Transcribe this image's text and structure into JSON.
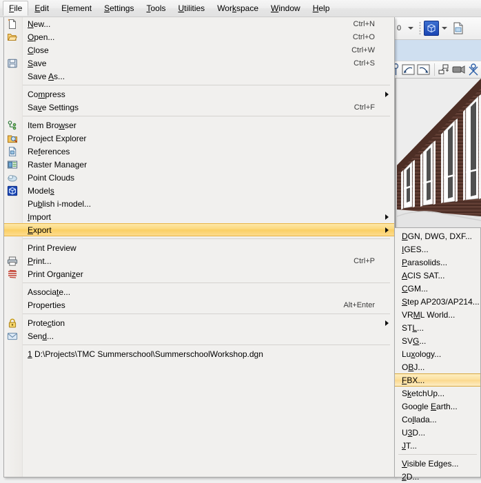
{
  "menubar": {
    "items": [
      {
        "label": "File",
        "mnemonic": "F",
        "open": true
      },
      {
        "label": "Edit",
        "mnemonic": "E",
        "open": false
      },
      {
        "label": "Element",
        "mnemonic": "l",
        "open": false
      },
      {
        "label": "Settings",
        "mnemonic": "S",
        "open": false
      },
      {
        "label": "Tools",
        "mnemonic": "T",
        "open": false
      },
      {
        "label": "Utilities",
        "mnemonic": "U",
        "open": false
      },
      {
        "label": "Workspace",
        "mnemonic": "k",
        "open": false
      },
      {
        "label": "Window",
        "mnemonic": "W",
        "open": false
      },
      {
        "label": "Help",
        "mnemonic": "H",
        "open": false
      }
    ]
  },
  "toolbar": {
    "level_value": "0",
    "level_dropdown_icon": "chevron-down-icon",
    "model_icon": "cube-icon",
    "model_dropdown_icon": "chevron-down-icon",
    "new_file_icon": "document-icon",
    "row2": [
      {
        "icon": "measure-icon"
      },
      {
        "icon": "undo-arc-icon"
      },
      {
        "icon": "redo-arc-icon"
      },
      {
        "icon": "copy-element-icon"
      },
      {
        "icon": "camera-icon"
      },
      {
        "icon": "render-icon"
      }
    ]
  },
  "viewport": {
    "name": "3d-building-render",
    "description": "Brick facade building with windows"
  },
  "file_menu": {
    "groups": [
      [
        {
          "label": "New...",
          "mnemonic": "N",
          "accel": "Ctrl+N",
          "icon": "new-document-icon",
          "submenu": false
        },
        {
          "label": "Open...",
          "mnemonic": "O",
          "accel": "Ctrl+O",
          "icon": "open-folder-icon",
          "submenu": false
        },
        {
          "label": "Close",
          "mnemonic": "C",
          "accel": "Ctrl+W",
          "icon": "",
          "submenu": false
        },
        {
          "label": "Save",
          "mnemonic": "S",
          "accel": "Ctrl+S",
          "icon": "save-disk-icon",
          "submenu": false
        },
        {
          "label": "Save As...",
          "mnemonic": "A",
          "accel": "",
          "icon": "",
          "submenu": false
        }
      ],
      [
        {
          "label": "Compress",
          "mnemonic": "m",
          "accel": "",
          "icon": "",
          "submenu": true
        },
        {
          "label": "Save Settings",
          "mnemonic": "v",
          "accel": "Ctrl+F",
          "icon": "",
          "submenu": false
        }
      ],
      [
        {
          "label": "Item Browser",
          "mnemonic": "w",
          "accel": "",
          "icon": "item-browser-icon",
          "submenu": false
        },
        {
          "label": "Project Explorer",
          "mnemonic": "j",
          "accel": "",
          "icon": "project-explorer-icon",
          "submenu": false
        },
        {
          "label": "References",
          "mnemonic": "f",
          "accel": "",
          "icon": "references-icon",
          "submenu": false
        },
        {
          "label": "Raster Manager",
          "mnemonic": "g",
          "accel": "",
          "icon": "raster-manager-icon",
          "submenu": false
        },
        {
          "label": "Point Clouds",
          "mnemonic": "",
          "accel": "",
          "icon": "point-clouds-icon",
          "submenu": false
        },
        {
          "label": "Models",
          "mnemonic": "s",
          "accel": "",
          "icon": "models-icon",
          "submenu": false
        },
        {
          "label": "Publish i-model...",
          "mnemonic": "b",
          "accel": "",
          "icon": "",
          "submenu": false
        },
        {
          "label": "Import",
          "mnemonic": "I",
          "accel": "",
          "icon": "",
          "submenu": true
        },
        {
          "label": "Export",
          "mnemonic": "E",
          "accel": "",
          "icon": "",
          "submenu": true,
          "selected": true
        }
      ],
      [
        {
          "label": "Print Preview",
          "mnemonic": "",
          "accel": "",
          "icon": "",
          "submenu": false
        },
        {
          "label": "Print...",
          "mnemonic": "P",
          "accel": "Ctrl+P",
          "icon": "printer-icon",
          "submenu": false
        },
        {
          "label": "Print Organizer",
          "mnemonic": "z",
          "accel": "",
          "icon": "print-organizer-icon",
          "submenu": false
        }
      ],
      [
        {
          "label": "Associate...",
          "mnemonic": "t",
          "accel": "",
          "icon": "",
          "submenu": false
        },
        {
          "label": "Properties",
          "mnemonic": "",
          "accel": "Alt+Enter",
          "icon": "",
          "submenu": false
        }
      ],
      [
        {
          "label": "Protection",
          "mnemonic": "c",
          "accel": "",
          "icon": "lock-icon",
          "submenu": true
        },
        {
          "label": "Send...",
          "mnemonic": "d",
          "accel": "",
          "icon": "envelope-icon",
          "submenu": false
        }
      ],
      [
        {
          "label": "1 D:\\Projects\\TMC Summerschool\\SummerschoolWorkshop.dgn",
          "mnemonic": "1",
          "accel": "",
          "icon": "",
          "submenu": false
        }
      ]
    ]
  },
  "export_submenu": {
    "groups": [
      [
        {
          "label": "DGN, DWG, DXF...",
          "mnemonic": "D"
        },
        {
          "label": "IGES...",
          "mnemonic": "I"
        },
        {
          "label": "Parasolids...",
          "mnemonic": "P"
        },
        {
          "label": "ACIS SAT...",
          "mnemonic": "A"
        },
        {
          "label": "CGM...",
          "mnemonic": "C"
        },
        {
          "label": "Step AP203/AP214...",
          "mnemonic": "S"
        },
        {
          "label": "VRML World...",
          "mnemonic": "M"
        },
        {
          "label": "STL...",
          "mnemonic": "L"
        },
        {
          "label": "SVG...",
          "mnemonic": "G"
        },
        {
          "label": "Luxology...",
          "mnemonic": "x"
        },
        {
          "label": "OBJ...",
          "mnemonic": "B"
        },
        {
          "label": "FBX...",
          "mnemonic": "F",
          "selected": true
        },
        {
          "label": "SketchUp...",
          "mnemonic": "k"
        },
        {
          "label": "Google Earth...",
          "mnemonic": "E"
        },
        {
          "label": "Collada...",
          "mnemonic": "l"
        },
        {
          "label": "U3D...",
          "mnemonic": "3"
        },
        {
          "label": "JT...",
          "mnemonic": "J"
        }
      ],
      [
        {
          "label": "Visible Edges...",
          "mnemonic": "V"
        },
        {
          "label": "2D...",
          "mnemonic": "2"
        }
      ]
    ]
  },
  "colors": {
    "highlight_gold": "#fbcf63",
    "highlight_border": "#e8b341",
    "menu_bg": "#f1f0ee",
    "brick": "#5c3a33",
    "accent_blue": "#1a46b4"
  }
}
